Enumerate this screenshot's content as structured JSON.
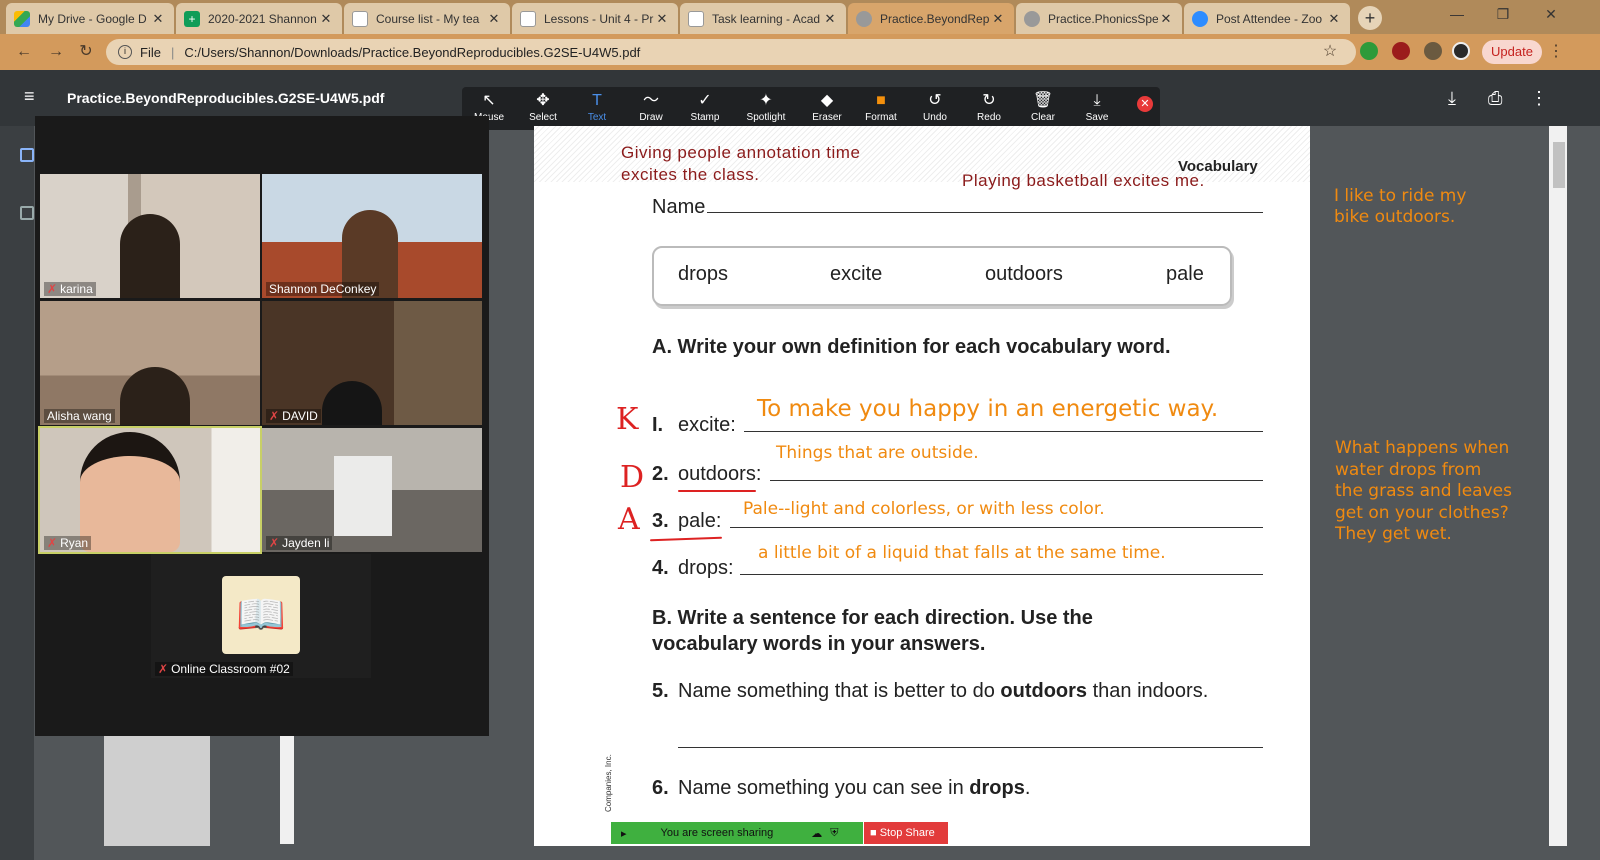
{
  "browser": {
    "tabs": [
      {
        "title": "My Drive - Google D",
        "icon": "google-drive-icon",
        "color": "#4285f4"
      },
      {
        "title": "2020-2021 Shannon",
        "icon": "google-sheets-icon",
        "color": "#0f9d58"
      },
      {
        "title": "Course list - My tea",
        "icon": "page-icon",
        "color": "#f5f5f5"
      },
      {
        "title": "Lessons - Unit 4 - Pr",
        "icon": "page-icon",
        "color": "#f5f5f5"
      },
      {
        "title": "Task learning - Acad",
        "icon": "page-icon",
        "color": "#f5f5f5"
      },
      {
        "title": "Practice.BeyondRep",
        "icon": "globe-icon",
        "color": "#888888",
        "active": true
      },
      {
        "title": "Practice.PhonicsSpe",
        "icon": "globe-icon",
        "color": "#888888"
      },
      {
        "title": "Post Attendee - Zoo",
        "icon": "zoom-icon",
        "color": "#2d8cff"
      }
    ],
    "address": {
      "scheme": "File",
      "path": "C:/Users/Shannon/Downloads/Practice.BeyondReproducibles.G2SE-U4W5.pdf"
    },
    "update_label": "Update"
  },
  "pdf": {
    "filename": "Practice.BeyondReproducibles.G2SE-U4W5.pdf"
  },
  "annotate_tools": [
    {
      "label": "Mouse",
      "glyph": "↖"
    },
    {
      "label": "Select",
      "glyph": "✥"
    },
    {
      "label": "Text",
      "glyph": "T",
      "active": true
    },
    {
      "label": "Draw",
      "glyph": "〜"
    },
    {
      "label": "Stamp",
      "glyph": "✓"
    },
    {
      "label": "Spotlight",
      "glyph": "✦"
    },
    {
      "label": "Eraser",
      "glyph": "◆"
    },
    {
      "label": "Format",
      "glyph": "■"
    },
    {
      "label": "Undo",
      "glyph": "↺"
    },
    {
      "label": "Redo",
      "glyph": "↻"
    },
    {
      "label": "Clear",
      "glyph": "🗑"
    },
    {
      "label": "Save",
      "glyph": "⤓"
    }
  ],
  "participants": [
    {
      "name": "karina",
      "muted": true
    },
    {
      "name": "Shannon DeConkey",
      "muted": false
    },
    {
      "name": "Alisha wang",
      "muted": false
    },
    {
      "name": "DAVID",
      "muted": true
    },
    {
      "name": "Ryan",
      "muted": true,
      "highlighted": true
    },
    {
      "name": "Jayden li",
      "muted": true
    },
    {
      "name": "Online Classroom #02",
      "muted": true
    }
  ],
  "worksheet": {
    "header": "Vocabulary",
    "name_label": "Name",
    "words": [
      "drops",
      "excite",
      "outdoors",
      "pale"
    ],
    "section_a": "A. Write your own definition for each vocabulary word.",
    "items_a": [
      {
        "num": "I.",
        "word": "excite:"
      },
      {
        "num": "2.",
        "word": "outdoors:"
      },
      {
        "num": "3.",
        "word": "pale:"
      },
      {
        "num": "4.",
        "word": "drops:"
      }
    ],
    "section_b_line1": "B. Write a sentence for each direction. Use the",
    "section_b_line2": "vocabulary words in your answers.",
    "item5_num": "5.",
    "item5_pre": "Name something that is better to do ",
    "item5_bold": "outdoors",
    "item5_post": " than indoors.",
    "item6_num": "6.",
    "item6_pre": "Name something you can see in ",
    "item6_bold": "drops",
    "item6_post": ".",
    "publisher_vertical": "Companies, Inc."
  },
  "annotations": {
    "teacher_line1": "Giving people annotation time",
    "teacher_line2": "excites the class.",
    "sentence": "Playing basketball excites me.",
    "def_excite": "To make you happy in an energetic way.",
    "def_outdoors": "Things that are outside.",
    "def_pale": "Pale--light and colorless, or with less color.",
    "def_drops": "a little bit of a liquid that falls at the same time.",
    "side1_line1": "I like to ride my",
    "side1_line2": "bike outdoors.",
    "side2_line1": "What happens when",
    "side2_line2": "water drops from",
    "side2_line3": "the grass and leaves",
    "side2_line4": "get on your clothes?",
    "side2_line5": "They get wet.",
    "initial_k": "K",
    "initial_d": "D",
    "initial_a": "A"
  },
  "share": {
    "status": "You are screen sharing",
    "stop_label": "Stop Share"
  }
}
